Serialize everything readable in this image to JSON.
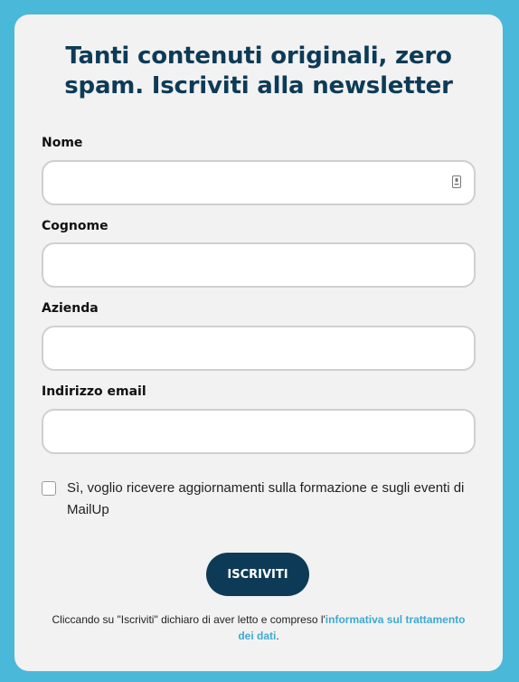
{
  "form": {
    "title": "Tanti contenuti originali, zero spam. Iscriviti alla newsletter",
    "fields": [
      {
        "label": "Nome",
        "value": "",
        "placeholder": ""
      },
      {
        "label": "Cognome",
        "value": "",
        "placeholder": ""
      },
      {
        "label": "Azienda",
        "value": "",
        "placeholder": ""
      },
      {
        "label": "Indirizzo email",
        "value": "",
        "placeholder": ""
      }
    ],
    "autofill_icon": "contact-card-icon",
    "consent": {
      "checked": false,
      "label": "Sì, voglio ricevere aggiornamenti sulla formazione e sugli eventi di MailUp"
    },
    "submit_label": "ISCRIVITI",
    "privacy": {
      "text_before": "Cliccando su \"Iscriviti\" dichiaro di aver letto e compreso l'",
      "link_text": "informativa sul trattamento dei dati",
      "text_after": "."
    }
  },
  "colors": {
    "page_background": "#4ab8d9",
    "card_background": "#f2f2f2",
    "title": "#0d3b57",
    "button": "#0d3b57",
    "link": "#3fa9cf",
    "input_border": "#cfcfcf"
  }
}
